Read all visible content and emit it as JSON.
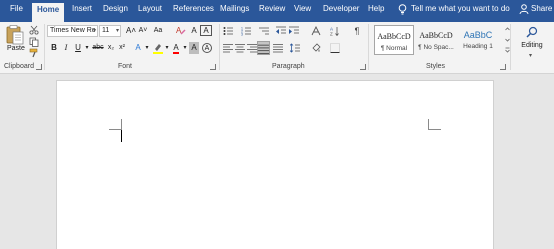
{
  "tabs": [
    {
      "label": "File"
    },
    {
      "label": "Home",
      "active": true
    },
    {
      "label": "Insert"
    },
    {
      "label": "Design"
    },
    {
      "label": "Layout"
    },
    {
      "label": "References"
    },
    {
      "label": "Mailings"
    },
    {
      "label": "Review"
    },
    {
      "label": "View"
    },
    {
      "label": "Developer"
    },
    {
      "label": "Help"
    }
  ],
  "tell_me": {
    "label": "Tell me what you want to do"
  },
  "share": {
    "label": "Share"
  },
  "clipboard": {
    "paste_label": "Paste",
    "group_label": "Clipboard"
  },
  "font": {
    "name": "Times New Ro",
    "size": "11",
    "group_label": "Font",
    "bold_label": "B",
    "italic_label": "I",
    "underline_label": "U",
    "strike_label": "abc",
    "subscript_label": "x₂",
    "superscript_label": "x²",
    "grow_label": "A˄",
    "shrink_label": "A˅",
    "case_label": "Aa",
    "effects_label": "A",
    "color_label": "A",
    "phonetic_label": "A",
    "enclose_label": "A"
  },
  "paragraph": {
    "group_label": "Paragraph",
    "marks_label": "¶"
  },
  "styles": {
    "group_label": "Styles",
    "items": [
      {
        "sample": "AaBbCcD",
        "name": "¶ Normal",
        "selected": true
      },
      {
        "sample": "AaBbCcD",
        "name": "¶ No Spac..."
      },
      {
        "sample": "AaBbC",
        "name": "Heading 1"
      }
    ]
  },
  "editing": {
    "label": "Editing"
  },
  "colors": {
    "accent": "#2b579a",
    "heading": "#2e74b5",
    "highlight": "#ffff00",
    "font_color": "#ff0000"
  }
}
